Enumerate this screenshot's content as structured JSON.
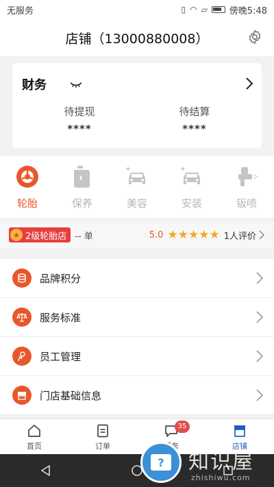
{
  "status_bar": {
    "carrier": "无服务",
    "time": "傍晚5:48"
  },
  "header": {
    "title": "店铺（13000880008）"
  },
  "finance": {
    "title": "财务",
    "items": [
      {
        "label": "待提现",
        "value": "****"
      },
      {
        "label": "待结算",
        "value": "****"
      }
    ]
  },
  "categories": [
    {
      "label": "轮胎",
      "icon": "tire-icon",
      "active": true
    },
    {
      "label": "保养",
      "icon": "oil-can-icon",
      "active": false
    },
    {
      "label": "美容",
      "icon": "car-beauty-icon",
      "active": false
    },
    {
      "label": "安装",
      "icon": "car-install-icon",
      "active": false
    },
    {
      "label": "钣喷",
      "icon": "spray-gun-icon",
      "active": false
    }
  ],
  "level": {
    "badge": "2级轮胎店",
    "orders": "-- 单",
    "rating_score": "5.0",
    "stars": 5,
    "review_count": "1人评价"
  },
  "menu": [
    {
      "label": "品牌积分",
      "icon": "coins-icon"
    },
    {
      "label": "服务标准",
      "icon": "scale-icon"
    },
    {
      "label": "员工管理",
      "icon": "staff-icon"
    },
    {
      "label": "门店基础信息",
      "icon": "storefront-icon"
    }
  ],
  "tabbar": [
    {
      "label": "首页",
      "icon": "home-icon"
    },
    {
      "label": "订单",
      "icon": "order-icon"
    },
    {
      "label": "服务",
      "icon": "message-icon",
      "badge": "35"
    },
    {
      "label": "店铺",
      "icon": "shop-icon",
      "active": true
    }
  ],
  "colors": {
    "accent": "#e8572b",
    "tab_active": "#1f5fc2",
    "badge": "#e24c4c"
  },
  "watermark": {
    "text": "知识屋",
    "sub": "zhishiwu.com"
  }
}
